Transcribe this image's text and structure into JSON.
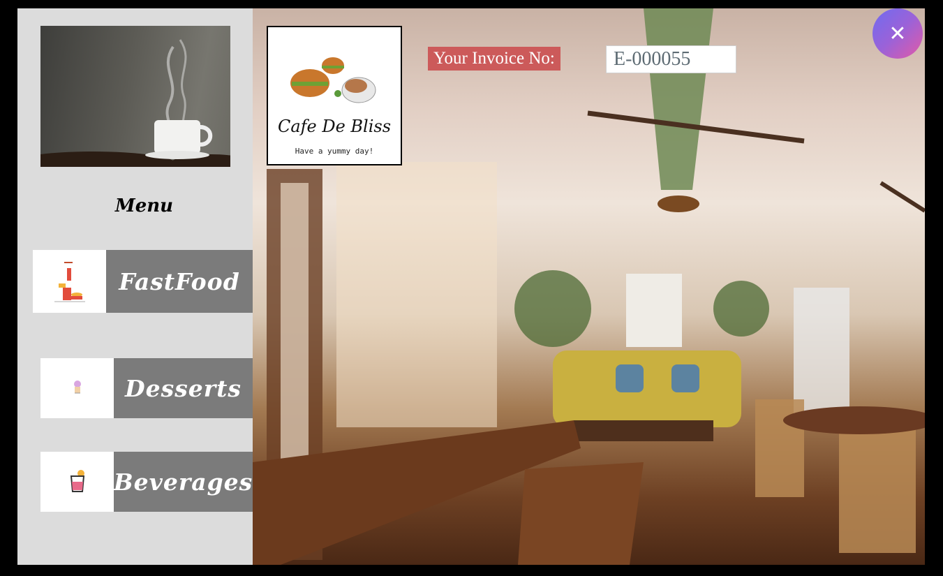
{
  "window": {
    "close_label": "✕"
  },
  "sidebar": {
    "menu_title": "Menu",
    "items": [
      {
        "label": "FastFood",
        "icon": "fastfood-icon"
      },
      {
        "label": "Desserts",
        "icon": "ice-cream-icon"
      },
      {
        "label": "Beverages",
        "icon": "drink-icon"
      }
    ]
  },
  "header": {
    "logo_name": "Cafe De Bliss",
    "logo_tagline": "Have a yummy day!",
    "invoice_label": "Your Invoice No:",
    "invoice_value": "E-000055"
  },
  "colors": {
    "sidebar_bg": "#dcdcdc",
    "menu_label_bg": "#7b7b7b",
    "invoice_label_bg": "#cc5a5a",
    "close_gradient_start": "#6f6cf0",
    "close_gradient_end": "#e25aa6"
  }
}
